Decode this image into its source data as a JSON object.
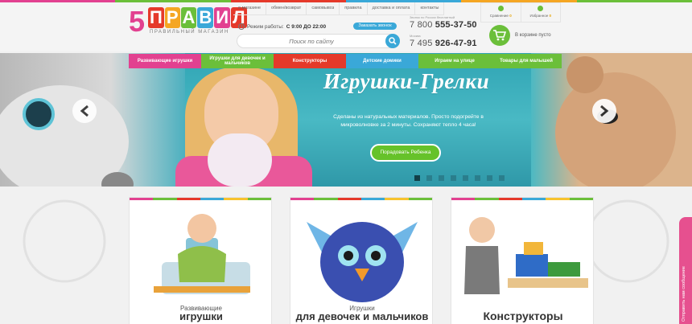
{
  "colors": {
    "pink": "#e24190",
    "green": "#6bbf3a",
    "red": "#e5392a",
    "blue": "#3aa8d8",
    "orange": "#f5a623",
    "yellow": "#f7c32e",
    "teal": "#2fa4b4"
  },
  "logo": {
    "number": "5",
    "word": "ПРАВИЛ",
    "tagline": "ПРАВИЛЬНЫЙ МАГАЗИН"
  },
  "topnav": [
    "о магазине",
    "обмен/возврат",
    "самовывоз",
    "правила",
    "доставка и оплата",
    "контакты"
  ],
  "hours": {
    "label": "Режим работы:",
    "value": "С 9:00 ДО 22:00"
  },
  "callback_label": "Заказать звонок",
  "search": {
    "placeholder": "Поиск по сайту",
    "icon": "search-icon"
  },
  "phones": [
    {
      "note": "Звонок по России бесплатный",
      "prefix": "7 800",
      "number": "555-37-50"
    },
    {
      "note": "Москва",
      "prefix": "7 495",
      "number": "926-47-91"
    }
  ],
  "userbox": {
    "compare": {
      "label": "Сравнение",
      "count": "0",
      "icon": "compare-icon"
    },
    "wishlist": {
      "label": "Избранное",
      "count": "0",
      "icon": "heart-icon"
    }
  },
  "cart": {
    "label": "В корзине пусто",
    "icon": "cart-icon"
  },
  "categories": [
    {
      "label": "Развивающие игрушки",
      "color": "#e24190"
    },
    {
      "label": "Игрушки для девочек и мальчиков",
      "color": "#6bbf3a"
    },
    {
      "label": "Конструкторы",
      "color": "#e5392a"
    },
    {
      "label": "Детские домики",
      "color": "#3aa8d8"
    },
    {
      "label": "Играем на улице",
      "color": "#6bbf3a"
    },
    {
      "label": "Товары для малышей",
      "color": "#6bbf3a"
    }
  ],
  "hero": {
    "title": "Игрушки-Грелки",
    "text": "Сделаны из натуральных материалов. Просто подогрейте в микроволновке за 2 минуты. Сохраняют тепло 4 часа!",
    "button": "Порадовать Ребенка",
    "slides_total": 8,
    "active_slide": 1
  },
  "cards": [
    {
      "subtitle": "Развивающие",
      "title": "игрушки"
    },
    {
      "subtitle": "Игрушки",
      "title": "для девочек и мальчиков"
    },
    {
      "subtitle": "",
      "title": "Конструкторы"
    }
  ],
  "side_tab": "Отправить нам сообщение"
}
